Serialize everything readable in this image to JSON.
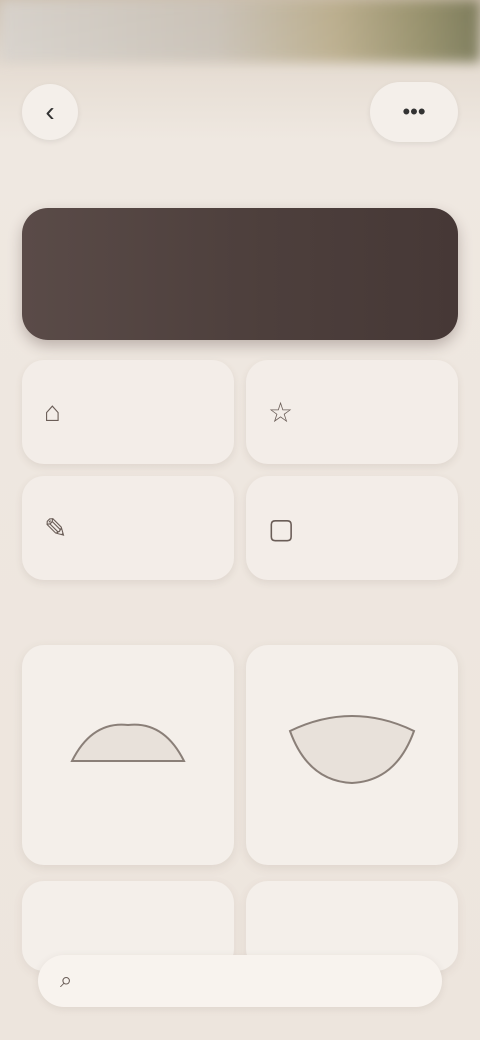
{
  "status_bar": {
    "time": "",
    "time_visible": true
  },
  "header": {
    "back_icon": "chevron-left-icon",
    "menu_icon": "more-horizontal-icon"
  },
  "section1": {
    "title": ""
  },
  "hero": {
    "line1": "",
    "line2": "",
    "line3": ""
  },
  "quick_actions": [
    {
      "icon": "tag-icon",
      "label": ""
    },
    {
      "icon": "star-icon",
      "label": ""
    },
    {
      "icon": "chat-icon",
      "label": ""
    },
    {
      "icon": "gift-icon",
      "label": ""
    }
  ],
  "section2": {
    "title": ""
  },
  "products": [
    {
      "name": ""
    },
    {
      "name": ""
    }
  ],
  "bottom_bar": {
    "label": ""
  }
}
